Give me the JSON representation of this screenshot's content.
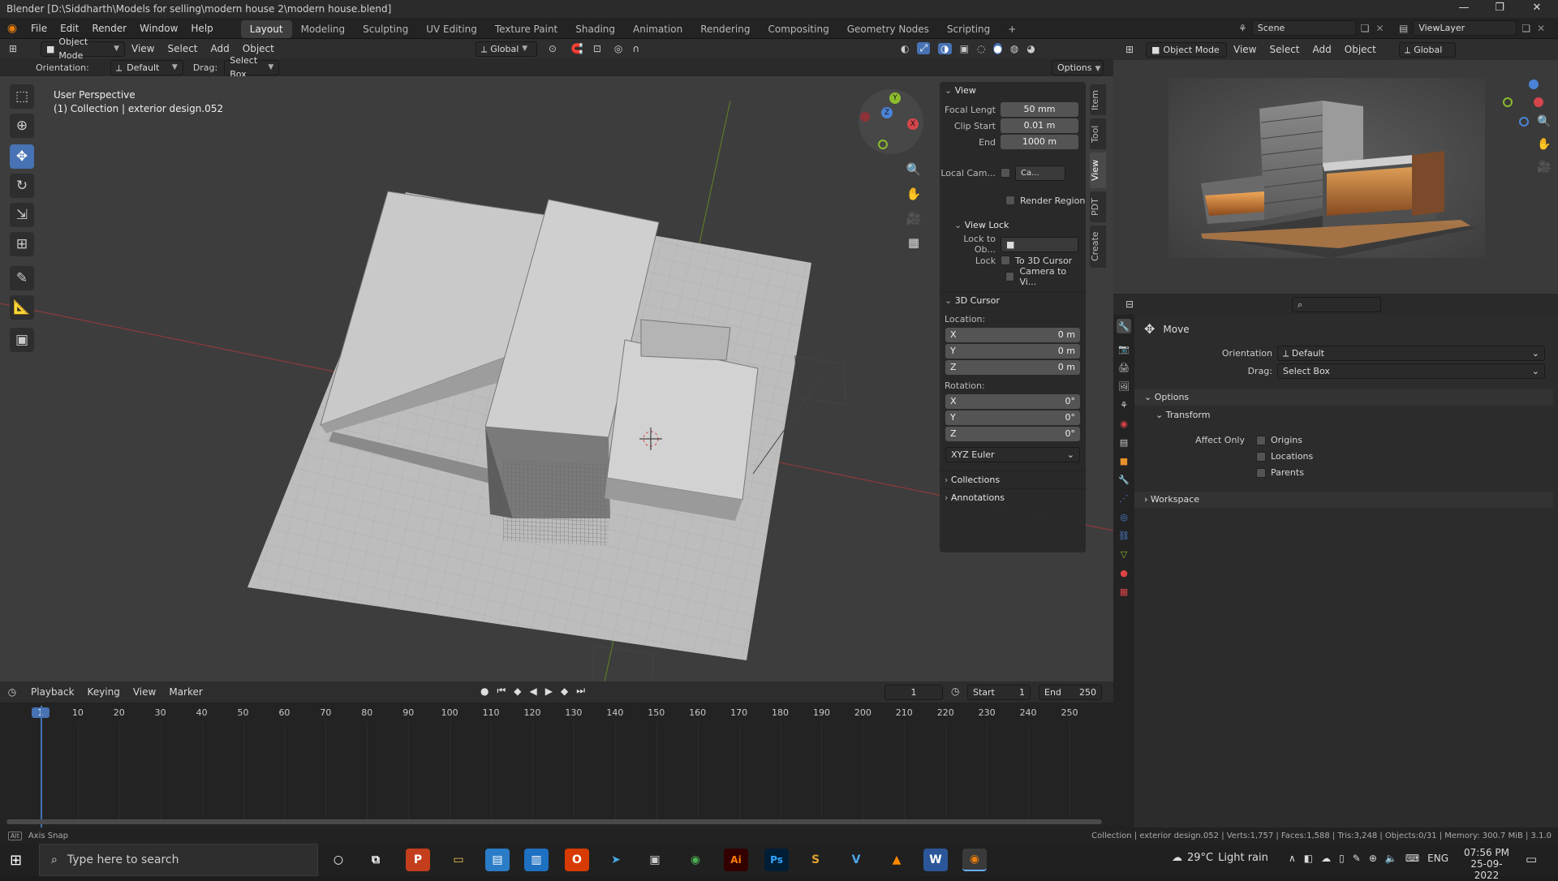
{
  "window": {
    "title": "Blender [D:\\Siddharth\\Models for selling\\modern house 2\\modern house.blend]",
    "minimize": "—",
    "maximize": "❐",
    "close": "✕"
  },
  "menu": [
    "File",
    "Edit",
    "Render",
    "Window",
    "Help"
  ],
  "workspaces": [
    "Layout",
    "Modeling",
    "Sculpting",
    "UV Editing",
    "Texture Paint",
    "Shading",
    "Animation",
    "Rendering",
    "Compositing",
    "Geometry Nodes",
    "Scripting"
  ],
  "active_workspace": "Layout",
  "scene": "Scene",
  "view_layer": "ViewLayer",
  "viewport_header": {
    "mode": "Object Mode",
    "menus": [
      "View",
      "Select",
      "Add",
      "Object"
    ],
    "transform": "Global"
  },
  "tool_settings": {
    "orientation_label": "Orientation:",
    "orientation_value": "Default",
    "drag_label": "Drag:",
    "drag_value": "Select Box",
    "options": "Options"
  },
  "overlay_text": {
    "perspective": "User Perspective",
    "collection": "(1) Collection | exterior design.052"
  },
  "gizmo": {
    "x": "X",
    "y": "Y",
    "z": "Z"
  },
  "npanel": {
    "view_header": "View",
    "focal_label": "Focal Lengt",
    "focal_value": "50 mm",
    "clip_start_label": "Clip Start",
    "clip_start_value": "0.01 m",
    "clip_end_label": "End",
    "clip_end_value": "1000 m",
    "local_cam_label": "Local Cam...",
    "local_cam_value": "Ca...",
    "render_region": "Render Region",
    "view_lock_header": "View Lock",
    "lock_to_obj_label": "Lock to Ob...",
    "lock_label": "Lock",
    "to_3d_cursor": "To 3D Cursor",
    "camera_to_view": "Camera to Vi...",
    "cursor_header": "3D Cursor",
    "location_label": "Location:",
    "loc_x": "0 m",
    "loc_y": "0 m",
    "loc_z": "0 m",
    "rotation_label": "Rotation:",
    "rot_x": "0°",
    "rot_y": "0°",
    "rot_z": "0°",
    "axis_x": "X",
    "axis_y": "Y",
    "axis_z": "Z",
    "rotation_mode": "XYZ Euler",
    "collections": "Collections",
    "annotations": "Annotations"
  },
  "side_tabs": [
    "Item",
    "Tool",
    "View",
    "PDT",
    "Create"
  ],
  "timeline": {
    "menus": [
      "Playback",
      "Keying",
      "View",
      "Marker"
    ],
    "current_frame": "1",
    "start_label": "Start",
    "start": "1",
    "end_label": "End",
    "end": "250",
    "ticks": [
      "1",
      "10",
      "20",
      "30",
      "40",
      "50",
      "60",
      "70",
      "80",
      "90",
      "100",
      "110",
      "120",
      "130",
      "140",
      "150",
      "160",
      "170",
      "180",
      "190",
      "200",
      "210",
      "220",
      "230",
      "240",
      "250"
    ]
  },
  "statusbar": {
    "left": "Axis Snap",
    "right": "Collection | exterior design.052 | Verts:1,757 | Faces:1,588 | Tris:3,248 | Objects:0/31 | Memory: 300.7 MiB | 3.1.0"
  },
  "right_viewport": {
    "mode": "Object Mode",
    "menus": [
      "View",
      "Select",
      "Add",
      "Object"
    ],
    "transform": "Global"
  },
  "properties": {
    "tool_name": "Move",
    "orientation_label": "Orientation",
    "orientation_value": "Default",
    "drag_label": "Drag:",
    "drag_value": "Select Box",
    "options_header": "Options",
    "transform_header": "Transform",
    "affect_only": "Affect Only",
    "origins": "Origins",
    "locations": "Locations",
    "parents": "Parents",
    "workspace": "Workspace"
  },
  "taskbar": {
    "search_placeholder": "Type here to search",
    "weather": "29°C",
    "weather_desc": "Light rain",
    "lang": "ENG",
    "time": "07:56 PM",
    "date": "25-09-2022"
  },
  "colors": {
    "accent": "#4772b3",
    "x_axis": "#d4464b",
    "y_axis": "#8dbb2e",
    "z_axis": "#4a84d8"
  }
}
